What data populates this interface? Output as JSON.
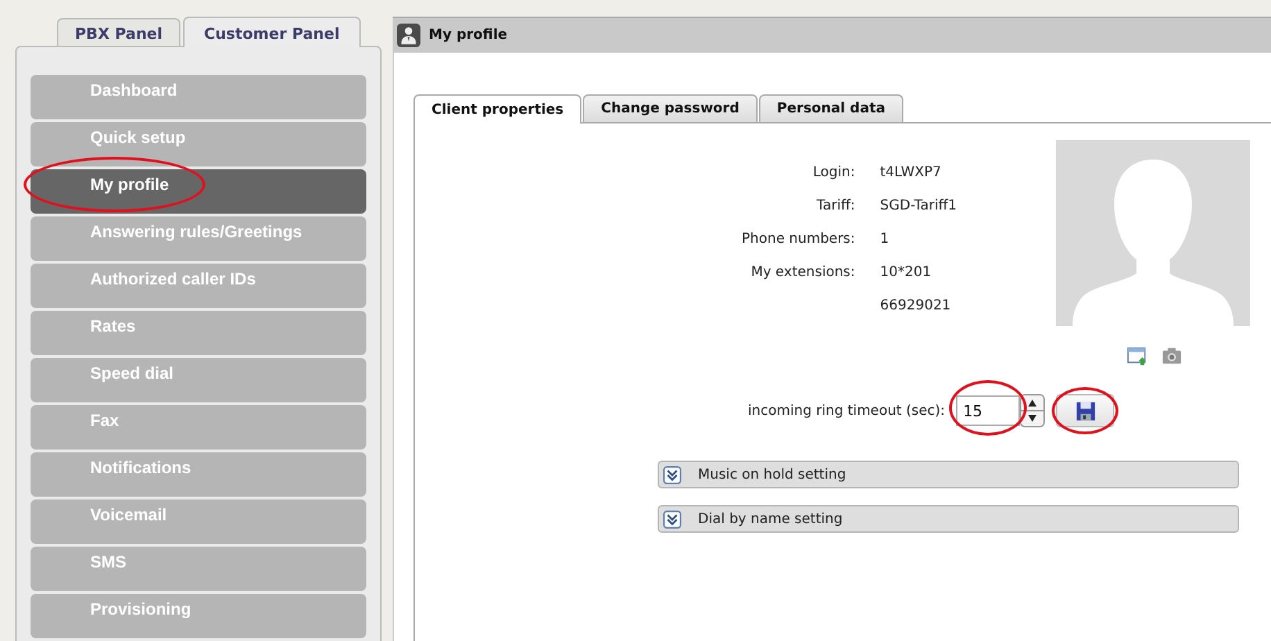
{
  "panel_tabs": [
    {
      "label": "PBX Panel",
      "selected": false
    },
    {
      "label": "Customer Panel",
      "selected": true
    }
  ],
  "nav": [
    {
      "label": "Dashboard",
      "selected": false,
      "circled": false
    },
    {
      "label": "Quick setup",
      "selected": false,
      "circled": false
    },
    {
      "label": "My profile",
      "selected": true,
      "circled": true
    },
    {
      "label": "Answering rules/Greetings",
      "selected": false,
      "circled": false
    },
    {
      "label": "Authorized caller IDs",
      "selected": false,
      "circled": false
    },
    {
      "label": "Rates",
      "selected": false,
      "circled": false
    },
    {
      "label": "Speed dial",
      "selected": false,
      "circled": false
    },
    {
      "label": "Fax",
      "selected": false,
      "circled": false
    },
    {
      "label": "Notifications",
      "selected": false,
      "circled": false
    },
    {
      "label": "Voicemail",
      "selected": false,
      "circled": false
    },
    {
      "label": "SMS",
      "selected": false,
      "circled": false
    },
    {
      "label": "Provisioning",
      "selected": false,
      "circled": false
    }
  ],
  "window": {
    "title": "My profile"
  },
  "tabs": [
    {
      "label": "Client properties",
      "selected": true
    },
    {
      "label": "Change password",
      "selected": false
    },
    {
      "label": "Personal data",
      "selected": false
    }
  ],
  "properties": [
    {
      "label": "Login:",
      "value": "t4LWXP7"
    },
    {
      "label": "Tariff:",
      "value": "SGD-Tariff1"
    },
    {
      "label": "Phone numbers:",
      "value": "1"
    },
    {
      "label": "My extensions:",
      "value": "10*201"
    },
    {
      "value": "66929021"
    }
  ],
  "ring_timeout": {
    "label": "incoming ring timeout (sec):",
    "value": "15",
    "circled": true
  },
  "save_button": {
    "circled": true
  },
  "sections": [
    {
      "label": "Music on hold setting",
      "expanded": false
    },
    {
      "label": "Dial by name setting",
      "expanded": false
    }
  ]
}
